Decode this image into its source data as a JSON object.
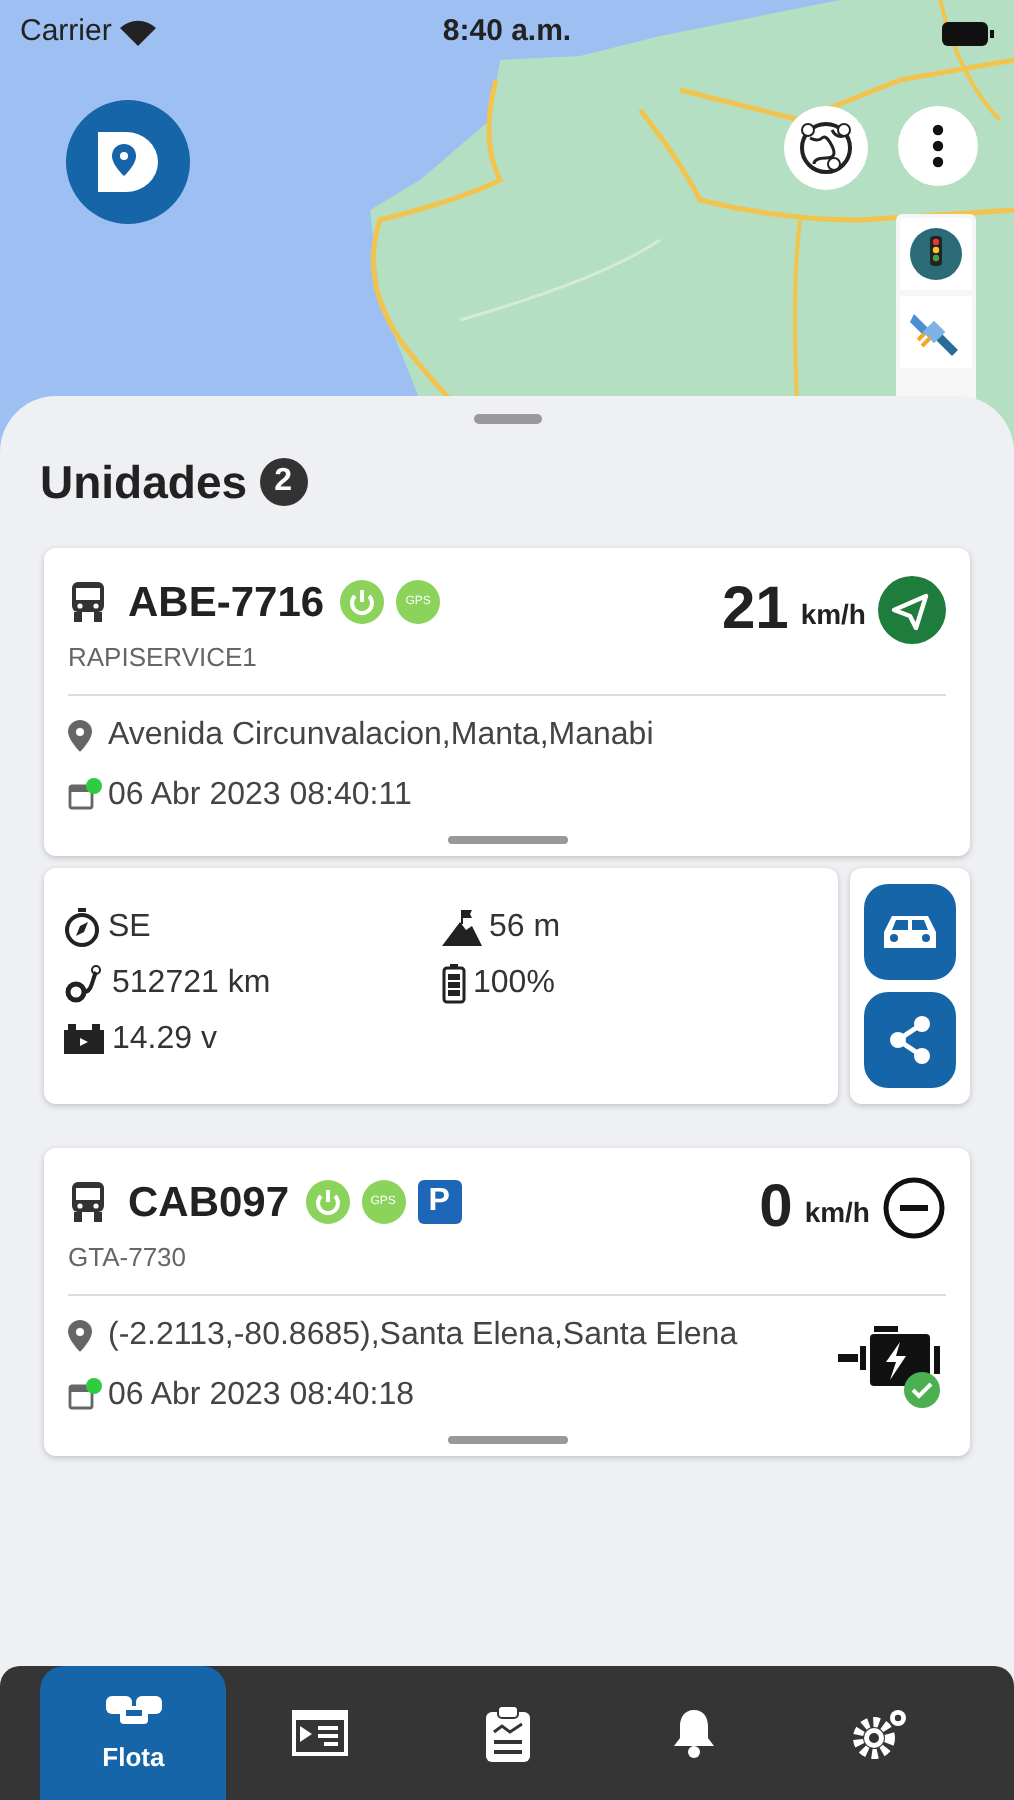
{
  "status_bar": {
    "carrier": "Carrier",
    "time": "8:40 a.m."
  },
  "sheet": {
    "title": "Unidades",
    "count": "2"
  },
  "units": [
    {
      "plate": "ABE-7716",
      "name": "RAPISERVICE1",
      "badges": [
        {
          "kind": "power"
        },
        {
          "kind": "gps",
          "text": "GPS"
        }
      ],
      "speed": "21",
      "speed_unit": "km/h",
      "moving": true,
      "address": "Avenida Circunvalacion,Manta,Manabi",
      "datetime": "06 Abr 2023 08:40:11",
      "online": true,
      "engine_indicator": false,
      "details": {
        "items": [
          {
            "kind": "heading",
            "value": "SE"
          },
          {
            "kind": "altitude",
            "value": "56 m"
          },
          {
            "kind": "odometer",
            "value": "512721 km"
          },
          {
            "kind": "battery",
            "value": "100%"
          },
          {
            "kind": "voltage",
            "value": "14.29 v"
          }
        ]
      }
    },
    {
      "plate": "CAB097",
      "name": "GTA-7730",
      "badges": [
        {
          "kind": "power"
        },
        {
          "kind": "gps",
          "text": "GPS"
        },
        {
          "kind": "parking",
          "text": "P"
        }
      ],
      "speed": "0",
      "speed_unit": "km/h",
      "moving": false,
      "address": "(-2.2113,-80.8685),Santa Elena,Santa Elena",
      "datetime": "06 Abr 2023 08:40:18",
      "online": true,
      "engine_indicator": true
    }
  ],
  "nav": [
    {
      "kind": "fleet",
      "label": "Flota",
      "selected": true
    },
    {
      "kind": "reports",
      "selected": false
    },
    {
      "kind": "checklist",
      "selected": false
    },
    {
      "kind": "alerts",
      "selected": false
    },
    {
      "kind": "settings",
      "selected": false
    }
  ]
}
